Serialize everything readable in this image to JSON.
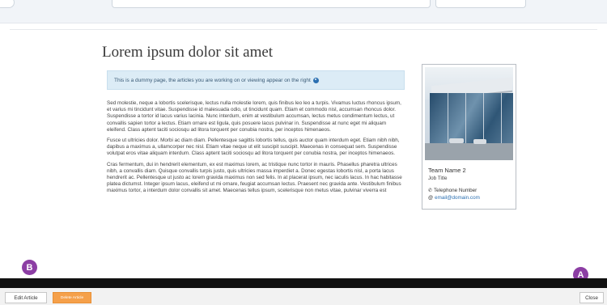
{
  "article": {
    "title": "Lorem ipsum dolor sit amet",
    "notice": "This is a dummy page, the articles you are working on or viewing appear on the right",
    "paragraphs": [
      "Sed molestie, neque a lobortis scelerisque, lectus nulla molestie lorem, quis finibus leo leo a turpis. Vivamus luctus rhoncus ipsum, et varius mi tincidunt vitae. Suspendisse id malesuada odio, ut tincidunt quam. Etiam et commodo nisl, accumsan rhoncus dolor. Suspendisse a tortor id lacus varius lacinia. Nunc interdum, enim at vestibulum accumsan, lectus metus condimentum lectus, ut convallis sapien tortor a lectus. Etiam ornare est ligula, quis posuere lacus pulvinar in. Suspendisse at nunc eget mi aliquam eleifend. Class aptent taciti sociosqu ad litora torquent per conubia nostra, per inceptos himenaeos.",
      "Fusce ut ultricies dolor. Morbi ac diam diam. Pellentesque sagittis lobortis tellus, quis auctor quam interdum eget. Etiam nibh nibh, dapibus a maximus a, ullamcorper nec nisl. Etiam vitae neque ut elit suscipit suscipit. Maecenas in consequat sem. Suspendisse volutpat eros vitae aliquam interdum. Class aptent taciti sociosqu ad litora torquent per conubia nostra, per inceptos himenaeos.",
      "Cras fermentum, dui in hendrerit elementum, ex est maximus lorem, ac tristique nunc tortor in mauris. Phasellus pharetra ultrices nibh, a convallis diam. Quisque convallis turpis justo, quis ultricies massa imperdiet a. Donec egestas lobortis nisl, a porta lacus hendrerit ac. Pellentesque ut justo ac lorem gravida maximus non sed felis. In at placerat ipsum, nec iaculis lacus. In hac habitasse platea dictumst. Integer ipsum lacus, eleifend ut mi ornare, feugiat accumsan lectus. Praesent nec gravida ante. Vestibulum finibus maximus tortor, a interdum dolor convallis sit amet. Maecenas tellus ipsum, scelerisque non metus vitae, pulvinar viverra est"
    ]
  },
  "card": {
    "team_name": "Team Name 2",
    "job_title": "Job Title",
    "telephone": "Telephone Number",
    "email": "email@domain.com"
  },
  "markers": {
    "left": "B",
    "right": "A"
  },
  "footer": {
    "edit_label": "Edit Article",
    "delete_label": "Delete Article",
    "close_label": "Close"
  },
  "colors": {
    "accent": "#2a6fb1",
    "delete_button": "#f5a04a",
    "marker": "#8c3ea4",
    "notice_bg": "#dcecf6"
  },
  "icons": {
    "notice": "arrow-right-circle-icon",
    "phone": "phone-icon",
    "email": "at-icon"
  }
}
